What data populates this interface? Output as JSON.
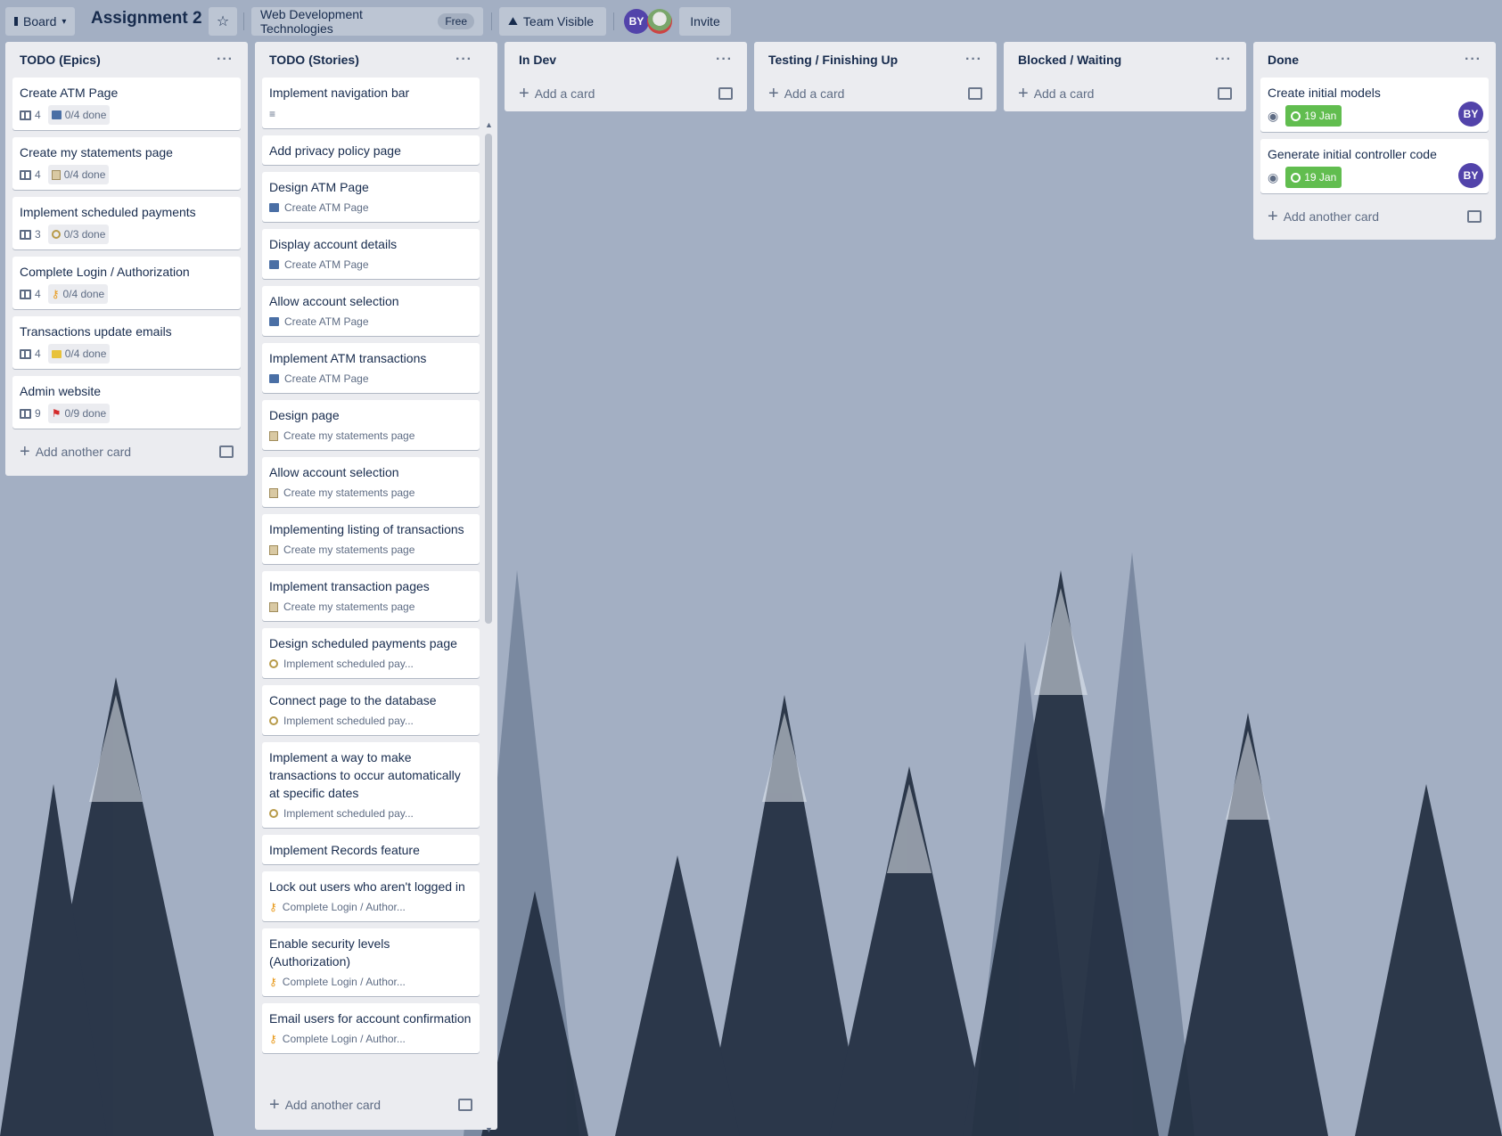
{
  "header": {
    "board_switcher": "Board",
    "title": "Assignment 2",
    "team_name": "Web Development Technologies",
    "team_badge": "Free",
    "visibility": "Team Visible",
    "avatar_initials": "BY",
    "invite": "Invite"
  },
  "lists": [
    {
      "title": "TODO (Epics)",
      "cards": [
        {
          "title": "Create ATM Page",
          "count": "4",
          "progress": "0/4 done"
        },
        {
          "title": "Create my statements page",
          "count": "4",
          "progress": "0/4 done"
        },
        {
          "title": "Implement scheduled payments",
          "count": "3",
          "progress": "0/3 done"
        },
        {
          "title": "Complete Login / Authorization",
          "count": "4",
          "progress": "0/4 done"
        },
        {
          "title": "Transactions update emails",
          "count": "4",
          "progress": "0/4 done"
        },
        {
          "title": "Admin website",
          "count": "9",
          "progress": "0/9 done"
        }
      ],
      "add_label": "Add another card"
    },
    {
      "title": "TODO (Stories)",
      "cards": [
        {
          "title": "Implement navigation bar",
          "epic": ""
        },
        {
          "title": "Add privacy policy page",
          "epic": ""
        },
        {
          "title": "Design ATM Page",
          "epic": "Create ATM Page"
        },
        {
          "title": "Display account details",
          "epic": "Create ATM Page"
        },
        {
          "title": "Allow account selection",
          "epic": "Create ATM Page"
        },
        {
          "title": "Implement ATM transactions",
          "epic": "Create ATM Page"
        },
        {
          "title": "Design page",
          "epic": "Create my statements page"
        },
        {
          "title": "Allow account selection",
          "epic": "Create my statements page"
        },
        {
          "title": "Implementing listing of transactions",
          "epic": "Create my statements page"
        },
        {
          "title": "Implement transaction pages",
          "epic": "Create my statements page"
        },
        {
          "title": "Design scheduled payments page",
          "epic": "Implement scheduled pay..."
        },
        {
          "title": "Connect page to the database",
          "epic": "Implement scheduled pay..."
        },
        {
          "title": "Implement a way to make transactions to occur automatically at specific dates",
          "epic": "Implement scheduled pay..."
        },
        {
          "title": "Implement Records feature",
          "epic": ""
        },
        {
          "title": "Lock out users who aren't logged in",
          "epic": "Complete Login / Author..."
        },
        {
          "title": "Enable security levels (Authorization)",
          "epic": "Complete Login / Author..."
        },
        {
          "title": "Email users for account confirmation",
          "epic": "Complete Login / Author..."
        }
      ],
      "add_label": "Add another card"
    },
    {
      "title": "In Dev",
      "add_label": "Add a card"
    },
    {
      "title": "Testing / Finishing Up",
      "add_label": "Add a card"
    },
    {
      "title": "Blocked / Waiting",
      "add_label": "Add a card"
    },
    {
      "title": "Done",
      "cards": [
        {
          "title": "Create initial models",
          "date": "19 Jan",
          "member": "BY"
        },
        {
          "title": "Generate initial controller code",
          "date": "19 Jan",
          "member": "BY"
        }
      ],
      "add_label": "Add another card"
    }
  ],
  "colors": {
    "accent": "#5243aa",
    "due_complete": "#61bd4f",
    "list_bg": "#ebecf0"
  }
}
